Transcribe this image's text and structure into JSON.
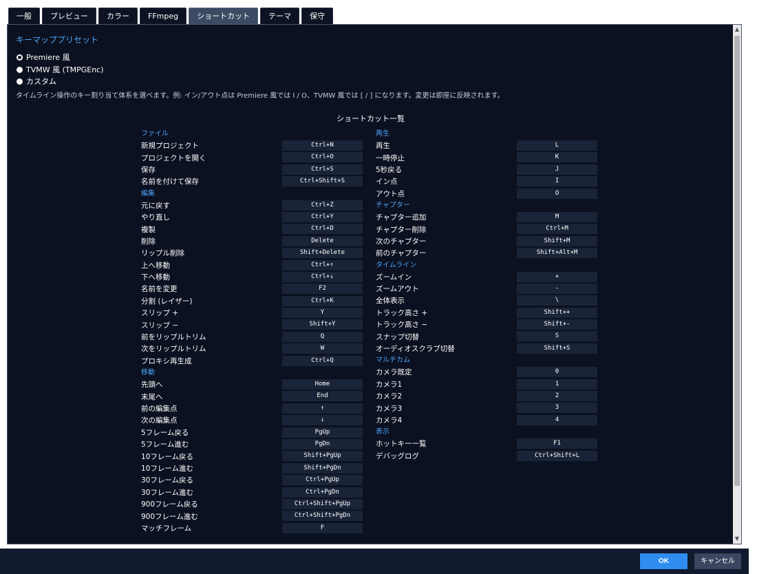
{
  "tabs": [
    {
      "label": "一般",
      "active": false
    },
    {
      "label": "プレビュー",
      "active": false
    },
    {
      "label": "カラー",
      "active": false
    },
    {
      "label": "FFmpeg",
      "active": false
    },
    {
      "label": "ショートカット",
      "active": true
    },
    {
      "label": "テーマ",
      "active": false
    },
    {
      "label": "保守",
      "active": false
    }
  ],
  "preset": {
    "title": "キーマッププリセット",
    "options": [
      {
        "label": "Premiere 風",
        "checked": true
      },
      {
        "label": "TVMW 風 (TMPGEnc)",
        "checked": false
      },
      {
        "label": "カスタム",
        "checked": false
      }
    ],
    "description": "タイムライン操作のキー割り当て体系を選べます。例: イン/アウト点は Premiere 風では I / O、TVMW 風では [ / ] になります。変更は即座に反映されます。"
  },
  "shortcut_list_title": "ショートカット一覧",
  "left_groups": [
    {
      "title": "ファイル",
      "items": [
        {
          "label": "新規プロジェクト",
          "key": "Ctrl+N"
        },
        {
          "label": "プロジェクトを開く",
          "key": "Ctrl+O"
        },
        {
          "label": "保存",
          "key": "Ctrl+S"
        },
        {
          "label": "名前を付けて保存",
          "key": "Ctrl+Shift+S"
        }
      ]
    },
    {
      "title": "編集",
      "items": [
        {
          "label": "元に戻す",
          "key": "Ctrl+Z"
        },
        {
          "label": "やり直し",
          "key": "Ctrl+Y"
        },
        {
          "label": "複製",
          "key": "Ctrl+D"
        },
        {
          "label": "削除",
          "key": "Delete"
        },
        {
          "label": "リップル削除",
          "key": "Shift+Delete"
        },
        {
          "label": "上へ移動",
          "key": "Ctrl+↑"
        },
        {
          "label": "下へ移動",
          "key": "Ctrl+↓"
        },
        {
          "label": "名前を変更",
          "key": "F2"
        },
        {
          "label": "分割 (レイザー)",
          "key": "Ctrl+K"
        },
        {
          "label": "スリップ +",
          "key": "Y"
        },
        {
          "label": "スリップ −",
          "key": "Shift+Y"
        },
        {
          "label": "前をリップルトリム",
          "key": "Q"
        },
        {
          "label": "次をリップルトリム",
          "key": "W"
        },
        {
          "label": "プロキシ再生成",
          "key": "Ctrl+Q"
        }
      ]
    },
    {
      "title": "移動",
      "items": [
        {
          "label": "先頭へ",
          "key": "Home"
        },
        {
          "label": "末尾へ",
          "key": "End"
        },
        {
          "label": "前の編集点",
          "key": "↑"
        },
        {
          "label": "次の編集点",
          "key": "↓"
        },
        {
          "label": "5フレーム戻る",
          "key": "PgUp"
        },
        {
          "label": "5フレーム進む",
          "key": "PgDn"
        },
        {
          "label": "10フレーム戻る",
          "key": "Shift+PgUp"
        },
        {
          "label": "10フレーム進む",
          "key": "Shift+PgDn"
        },
        {
          "label": "30フレーム戻る",
          "key": "Ctrl+PgUp"
        },
        {
          "label": "30フレーム進む",
          "key": "Ctrl+PgDn"
        },
        {
          "label": "900フレーム戻る",
          "key": "Ctrl+Shift+PgUp"
        },
        {
          "label": "900フレーム進む",
          "key": "Ctrl+Shift+PgDn"
        },
        {
          "label": "マッチフレーム",
          "key": "F"
        }
      ]
    }
  ],
  "right_groups": [
    {
      "title": "再生",
      "items": [
        {
          "label": "再生",
          "key": "L"
        },
        {
          "label": "一時停止",
          "key": "K"
        },
        {
          "label": "5秒戻る",
          "key": "J"
        },
        {
          "label": "イン点",
          "key": "I"
        },
        {
          "label": "アウト点",
          "key": "O"
        }
      ]
    },
    {
      "title": "チャプター",
      "items": [
        {
          "label": "チャプター追加",
          "key": "M"
        },
        {
          "label": "チャプター削除",
          "key": "Ctrl+M"
        },
        {
          "label": "次のチャプター",
          "key": "Shift+M"
        },
        {
          "label": "前のチャプター",
          "key": "Shift+Alt+M"
        }
      ]
    },
    {
      "title": "タイムライン",
      "items": [
        {
          "label": "ズームイン",
          "key": "+"
        },
        {
          "label": "ズームアウト",
          "key": "-"
        },
        {
          "label": "全体表示",
          "key": "\\"
        },
        {
          "label": "トラック高さ +",
          "key": "Shift++"
        },
        {
          "label": "トラック高さ −",
          "key": "Shift+-"
        },
        {
          "label": "スナップ切替",
          "key": "S"
        },
        {
          "label": "オーディオスクラブ切替",
          "key": "Shift+S"
        }
      ]
    },
    {
      "title": "マルチカム",
      "items": [
        {
          "label": "カメラ既定",
          "key": "0"
        },
        {
          "label": "カメラ1",
          "key": "1"
        },
        {
          "label": "カメラ2",
          "key": "2"
        },
        {
          "label": "カメラ3",
          "key": "3"
        },
        {
          "label": "カメラ4",
          "key": "4"
        }
      ]
    },
    {
      "title": "表示",
      "items": [
        {
          "label": "ホットキー一覧",
          "key": "F1"
        },
        {
          "label": "デバッグログ",
          "key": "Ctrl+Shift+L"
        }
      ]
    }
  ],
  "footer": {
    "ok_label": "OK",
    "cancel_label": "キャンセル"
  },
  "scrollbar": {
    "up_glyph": "▲",
    "down_glyph": "▼"
  }
}
